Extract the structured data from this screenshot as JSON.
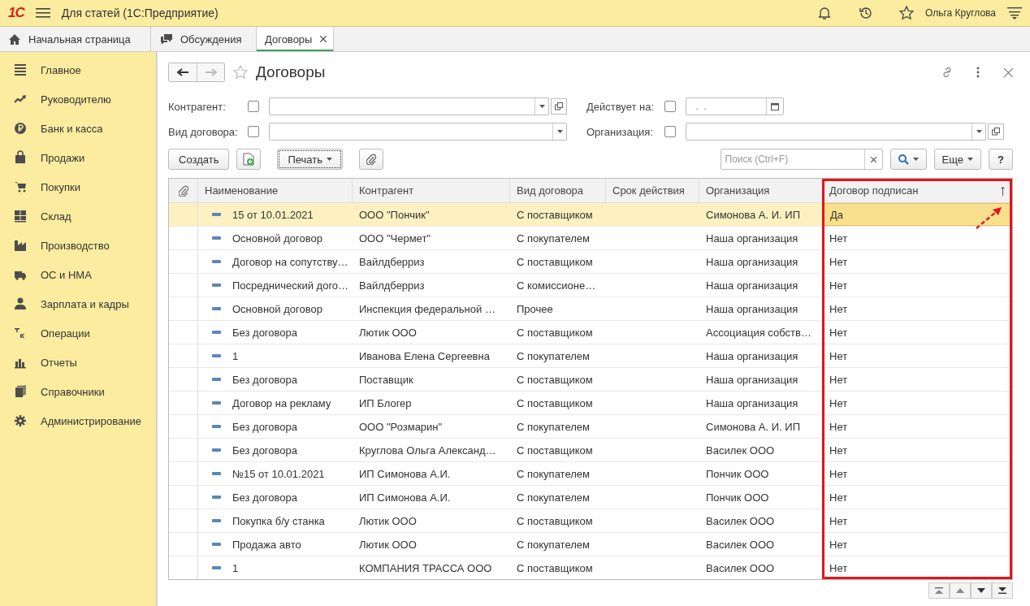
{
  "window": {
    "logo": "1С",
    "title": "Для статей  (1С:Предприятие)",
    "user": "Ольга Круглова"
  },
  "tabs": [
    {
      "label": "Начальная страница",
      "selected": false
    },
    {
      "label": "Обсуждения",
      "selected": false
    },
    {
      "label": "Договоры",
      "selected": true
    }
  ],
  "sidebar": {
    "items": [
      "Главное",
      "Руководителю",
      "Банк и касса",
      "Продажи",
      "Покупки",
      "Склад",
      "Производство",
      "ОС и НМА",
      "Зарплата и кадры",
      "Операции",
      "Отчеты",
      "Справочники",
      "Администрирование"
    ]
  },
  "form": {
    "title": "Договоры",
    "filters": [
      {
        "label": "Контрагент:",
        "checked": false,
        "kind": "ref"
      },
      {
        "label": "Действует на:",
        "checked": false,
        "kind": "date",
        "value": " .  ."
      },
      {
        "label": "Вид договора:",
        "checked": false,
        "kind": "choice"
      },
      {
        "label": "Организация:",
        "checked": false,
        "kind": "ref"
      }
    ],
    "buttons": {
      "create": "Создать",
      "print": "Печать",
      "more": "Еще",
      "help": "?"
    },
    "search": {
      "placeholder": "Поиск (Ctrl+F)"
    }
  },
  "table": {
    "columns": [
      {
        "label": "Наименование"
      },
      {
        "label": "Контрагент"
      },
      {
        "label": "Вид договора"
      },
      {
        "label": "Срок действия"
      },
      {
        "label": "Организация"
      },
      {
        "label": "Договор подписан",
        "sorted_ascending": true,
        "highlighted": true
      }
    ],
    "rows": [
      {
        "selected": true,
        "cells": [
          "15 от 10.01.2021",
          "ООО \"Пончик\"",
          "С поставщиком",
          null,
          "Симонова А. И. ИП",
          "Да"
        ]
      },
      {
        "selected": false,
        "cells": [
          "Основной договор",
          "ООО \"Чермет\"",
          "С покупателем",
          null,
          "Наша организация",
          "Нет"
        ]
      },
      {
        "selected": false,
        "cells": [
          "Договор на сопутству…",
          "Вайлдберриз",
          "С поставщиком",
          null,
          "Наша организация",
          "Нет"
        ]
      },
      {
        "selected": false,
        "cells": [
          "Посреднический дого…",
          "Вайлдберриз",
          "С комиссионе…",
          null,
          "Наша организация",
          "Нет"
        ]
      },
      {
        "selected": false,
        "cells": [
          "Основной договор",
          "Инспекция федеральной …",
          "Прочее",
          null,
          "Наша организация",
          "Нет"
        ]
      },
      {
        "selected": false,
        "cells": [
          "Без договора",
          "Лютик ООО",
          "С поставщиком",
          null,
          "Ассоциация собств…",
          "Нет"
        ]
      },
      {
        "selected": false,
        "cells": [
          "1",
          "Иванова Елена Сергеевна",
          "С покупателем",
          null,
          "Наша организация",
          "Нет"
        ]
      },
      {
        "selected": false,
        "cells": [
          "Без договора",
          "Поставщик",
          "С поставщиком",
          null,
          "Наша организация",
          "Нет"
        ]
      },
      {
        "selected": false,
        "cells": [
          "Договор на рекламу",
          "ИП Блогер",
          "С поставщиком",
          null,
          "Наша организация",
          "Нет"
        ]
      },
      {
        "selected": false,
        "cells": [
          "Без договора",
          "ООО \"Розмарин\"",
          "С покупателем",
          null,
          "Симонова А. И. ИП",
          "Нет"
        ]
      },
      {
        "selected": false,
        "cells": [
          "Без договора",
          "Круглова Ольга Александ…",
          "С поставщиком",
          null,
          "Василек ООО",
          "Нет"
        ]
      },
      {
        "selected": false,
        "cells": [
          "№15 от 10.01.2021",
          "ИП Симонова А.И.",
          "С покупателем",
          null,
          "Пончик ООО",
          "Нет"
        ]
      },
      {
        "selected": false,
        "cells": [
          "Без договора",
          "ИП Симонова А.И.",
          "С покупателем",
          null,
          "Пончик ООО",
          "Нет"
        ]
      },
      {
        "selected": false,
        "cells": [
          "Покупка б/у станка",
          "Лютик ООО",
          "С поставщиком",
          null,
          "Василек ООО",
          "Нет"
        ]
      },
      {
        "selected": false,
        "cells": [
          "Продажа авто",
          "Лютик ООО",
          "С покупателем",
          null,
          "Василек ООО",
          "Нет"
        ]
      },
      {
        "selected": false,
        "cells": [
          "1",
          "КОМПАНИЯ ТРАССА ООО",
          "С поставщиком",
          null,
          "Василек ООО",
          "Нет"
        ]
      }
    ]
  }
}
